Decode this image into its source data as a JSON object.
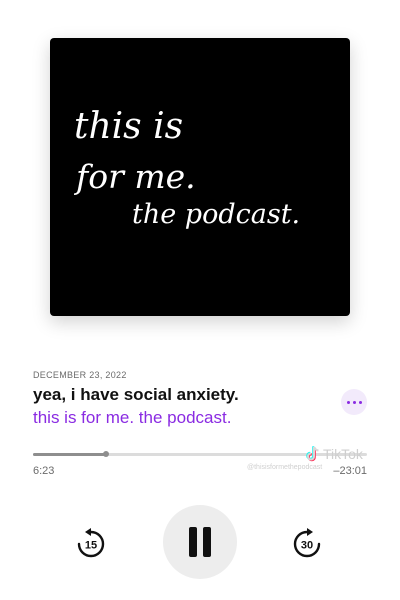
{
  "artwork": {
    "lines": [
      "this is",
      "for me.",
      "the podcast."
    ]
  },
  "episode": {
    "date": "DECEMBER 23, 2022",
    "title": "yea, i have social anxiety.",
    "show": "this is for me. the podcast."
  },
  "playback": {
    "elapsed": "6:23",
    "remaining": "–23:01",
    "progress_fraction": 0.22
  },
  "controls": {
    "skip_back_seconds": "15",
    "skip_forward_seconds": "30"
  },
  "watermark": {
    "brand": "TikTok",
    "handle": "@thisisformethepodcast"
  },
  "colors": {
    "accent": "#8a2be2",
    "background": "#ffffff",
    "artwork_bg": "#000000"
  }
}
